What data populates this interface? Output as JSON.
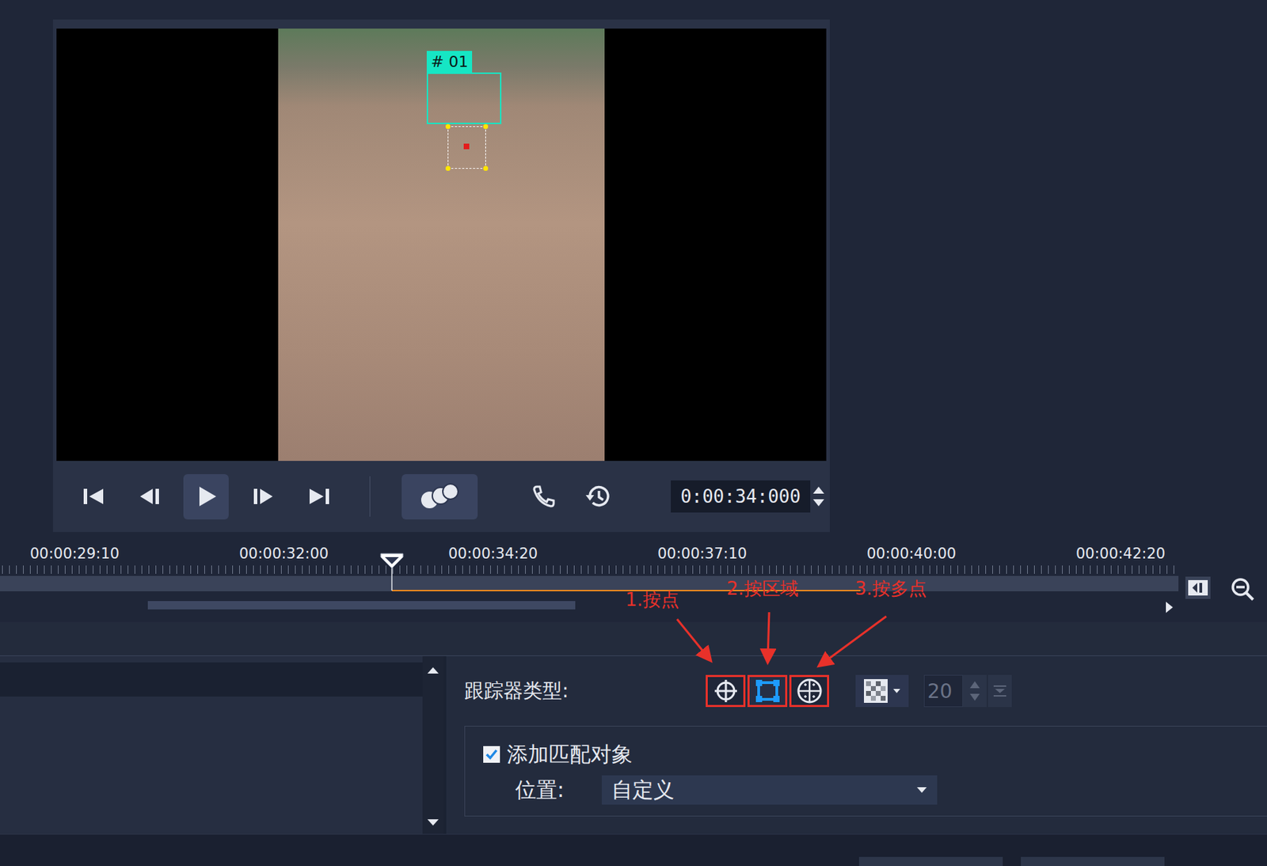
{
  "preview": {
    "tracker_label": "# 01",
    "timecode": "0:00:34:000"
  },
  "timeline": {
    "ticks": [
      "00:00:29:10",
      "00:00:32:00",
      "00:00:34:20",
      "00:00:37:10",
      "00:00:40:00",
      "00:00:42:20"
    ]
  },
  "annotations": [
    {
      "label": "1.按点"
    },
    {
      "label": "2.按区域"
    },
    {
      "label": "3.按多点"
    }
  ],
  "tracker": {
    "label": "跟踪器类型:",
    "types": [
      {
        "kind": "point",
        "selected": false
      },
      {
        "kind": "area",
        "selected": true
      },
      {
        "kind": "multipoint",
        "selected": false
      }
    ],
    "mosaic_size": {
      "value": "20",
      "disabled": true
    }
  },
  "match": {
    "label": "添加匹配对象",
    "checked": true,
    "position_label": "位置:",
    "position_value": "自定义"
  }
}
